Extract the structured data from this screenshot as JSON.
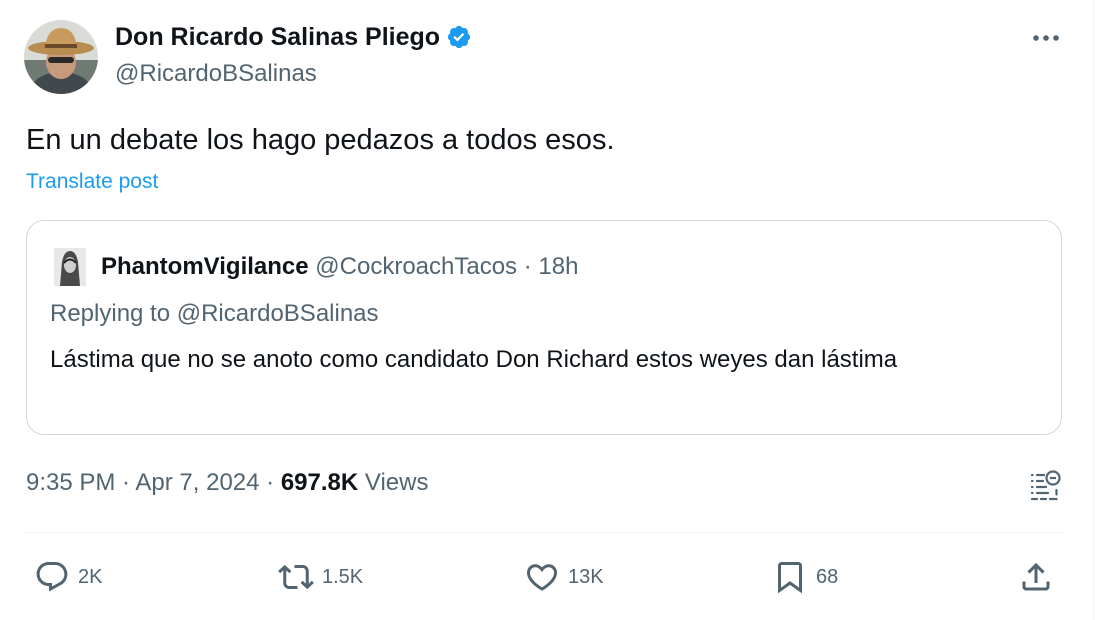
{
  "author": {
    "display_name": "Don Ricardo Salinas Pliego",
    "handle": "@RicardoBSalinas",
    "verified": true
  },
  "post": {
    "text": "En un debate los hago pedazos a todos esos.",
    "translate_label": "Translate post"
  },
  "quoted_post": {
    "display_name": "PhantomVigilance",
    "handle": "@CockroachTacos",
    "separator": " · ",
    "age": "18h",
    "replying_to": "Replying to @RicardoBSalinas",
    "text": "Lástima que no se anoto como candidato Don Richard  estos weyes dan lástima"
  },
  "meta": {
    "time": "9:35 PM",
    "separator": " · ",
    "date": "Apr 7, 2024",
    "views_count": "697.8K",
    "views_label": "Views"
  },
  "actions": {
    "replies": "2K",
    "reposts": "1.5K",
    "likes": "13K",
    "bookmarks": "68"
  },
  "icons": {
    "more": "more-icon",
    "verified": "verified-badge-icon",
    "analytics": "analytics-icon",
    "reply": "reply-icon",
    "repost": "repost-icon",
    "like": "heart-icon",
    "bookmark": "bookmark-icon",
    "share": "share-icon"
  },
  "colors": {
    "accent": "#1d9bf0",
    "text": "#0f1419",
    "secondary": "#536471",
    "border": "#cfd9de"
  }
}
